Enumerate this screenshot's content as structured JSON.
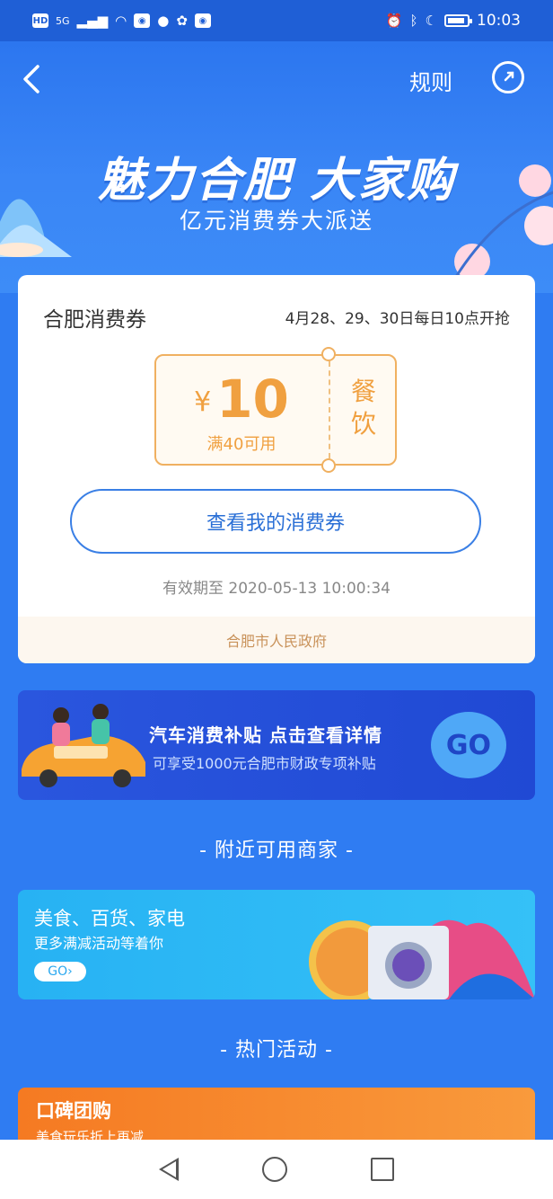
{
  "status_bar": {
    "hd": "HD",
    "network": "5G",
    "time": "10:03",
    "battery_level": 0.9
  },
  "header": {
    "back_icon": "chevron-left-icon",
    "rules_label": "规则",
    "share_icon": "share-icon"
  },
  "hero": {
    "title": "魅力合肥 大家购",
    "subtitle": "亿元消费券大派送"
  },
  "coupon_card": {
    "title": "合肥消费券",
    "schedule": "4月28、29、30日每日10点开抢",
    "currency": "¥",
    "amount": "10",
    "condition": "满40可用",
    "category_line1": "餐",
    "category_line2": "饮",
    "view_button": "查看我的消费券",
    "validity": "有效期至 2020-05-13 10:00:34",
    "issuer": "合肥市人民政府"
  },
  "car_banner": {
    "title": "汽车消费补贴 点击查看详情",
    "subtitle": "可享受1000元合肥市财政专项补贴",
    "go_label": "GO"
  },
  "nearby_section": {
    "title": "- 附近可用商家 -"
  },
  "shop_banner": {
    "title": "美食、百货、家电",
    "subtitle": "更多满减活动等着你",
    "go_label": "GO›"
  },
  "hot_section": {
    "title": "- 热门活动 -"
  },
  "group_banner": {
    "title": "口碑团购",
    "subtitle": "美食玩乐折上再减"
  },
  "colors": {
    "primary_blue": "#2f7cf2",
    "coupon_orange": "#f0a040",
    "group_orange": "#f57a22"
  }
}
